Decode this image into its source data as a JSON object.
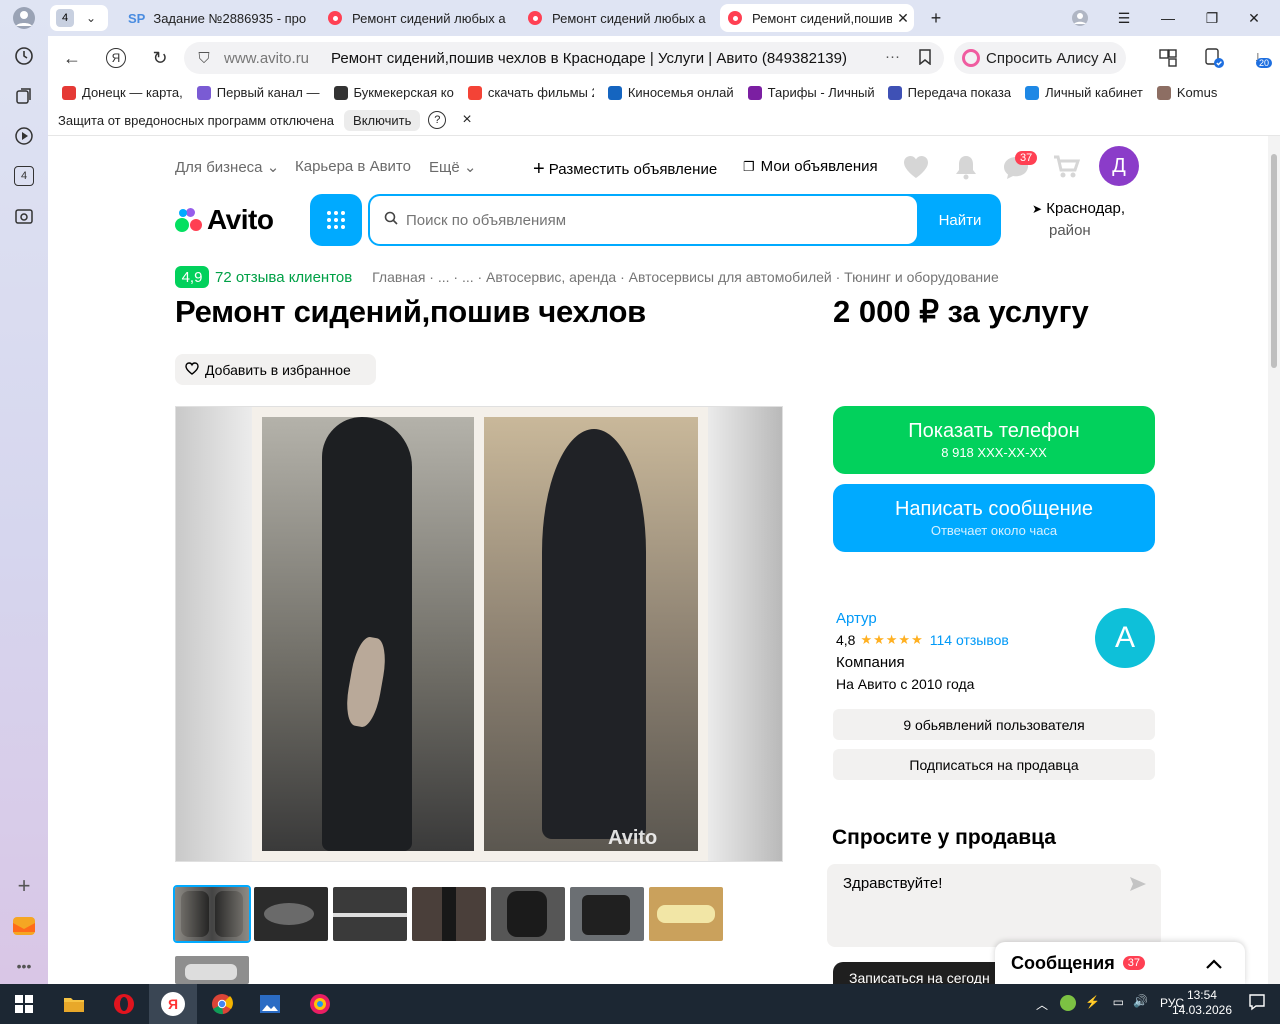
{
  "browser": {
    "tab_count": "4",
    "tabs": [
      {
        "title": "Задание №2886935 - про",
        "favicon": "SP"
      },
      {
        "title": "Ремонт сидений любых а"
      },
      {
        "title": "Ремонт сидений любых а"
      },
      {
        "title": "Ремонт сидений,пошив"
      }
    ],
    "new_tab": "+",
    "domain": "www.avito.ru",
    "page_title": "Ремонт сидений,пошив чехлов в Краснодаре | Услуги | Авито (849382139)",
    "alice": "Спросить Алису AI",
    "downloads_badge": "20",
    "yandex_glyph": "Я",
    "bookmarks": [
      {
        "label": "Донецк — карта,",
        "color": "#e53935"
      },
      {
        "label": "Первый канал —",
        "color": "#7a5bd4"
      },
      {
        "label": "Букмекерская ко",
        "color": "#333333"
      },
      {
        "label": "скачать фильмы 2",
        "color": "#f44336"
      },
      {
        "label": "Киносемья онлай",
        "color": "#1565c0"
      },
      {
        "label": "Тарифы - Личный",
        "color": "#7b1fa2"
      },
      {
        "label": "Передача показа",
        "color": "#3f51b5"
      },
      {
        "label": "Личный кабинет",
        "color": "#1e88e5"
      },
      {
        "label": "Komus",
        "color": "#8d6e63"
      }
    ],
    "protection_text": "Защита от вредоносных программ отключена",
    "protection_button": "Включить",
    "help_glyph": "?",
    "close_glyph": "×",
    "rail_badge": "4"
  },
  "header": {
    "business": "Для бизнеса",
    "career": "Карьера в Авито",
    "more": "Ещё",
    "post_ad": "Разместить объявление",
    "my_ads": "Мои объявления",
    "messages_badge": "37",
    "avatar_letter": "Д",
    "logo_text": "Avito",
    "search_placeholder": "Поиск по объявлениям",
    "search_button": "Найти",
    "region_line1": "Краснодар,",
    "region_line2": "район"
  },
  "listing": {
    "rating": "4,9",
    "reviews": "72 отзыва клиентов",
    "breadcrumbs": "Главная · ... · ... · Автосервис, аренда · Автосервисы для автомобилей · Тюнинг и оборудование",
    "title": "Ремонт сидений,пошив чехлов",
    "price": "2 000 ₽ за услугу",
    "favorite": "Добавить в избранное",
    "watermark": "Avito"
  },
  "contact": {
    "phone_label": "Показать телефон",
    "phone_number": "8 918 XXX-XX-XX",
    "message_label": "Написать сообщение",
    "message_sub": "Отвечает около часа"
  },
  "seller": {
    "name": "Артур",
    "rating": "4,8",
    "stars": 5,
    "reviews": "114 отзывов",
    "type": "Компания",
    "since": "На Авито с 2010 года",
    "avatar_letter": "А",
    "ads_button": "9 обьявлений пользователя",
    "subscribe_button": "Подписаться на продавца"
  },
  "ask": {
    "title": "Спросите у продавца",
    "text": "Здравствуйте!",
    "signup": "Записаться на сегодн",
    "messages_panel": "Сообщения",
    "messages_badge": "37"
  },
  "taskbar": {
    "lang": "РУС",
    "time": "13:54",
    "date": "14.03.2026"
  },
  "colors": {
    "accent": "#00aaff",
    "green": "#02d15c",
    "avatar_purple": "#8b3cc9",
    "badge_red": "#ff4053"
  }
}
